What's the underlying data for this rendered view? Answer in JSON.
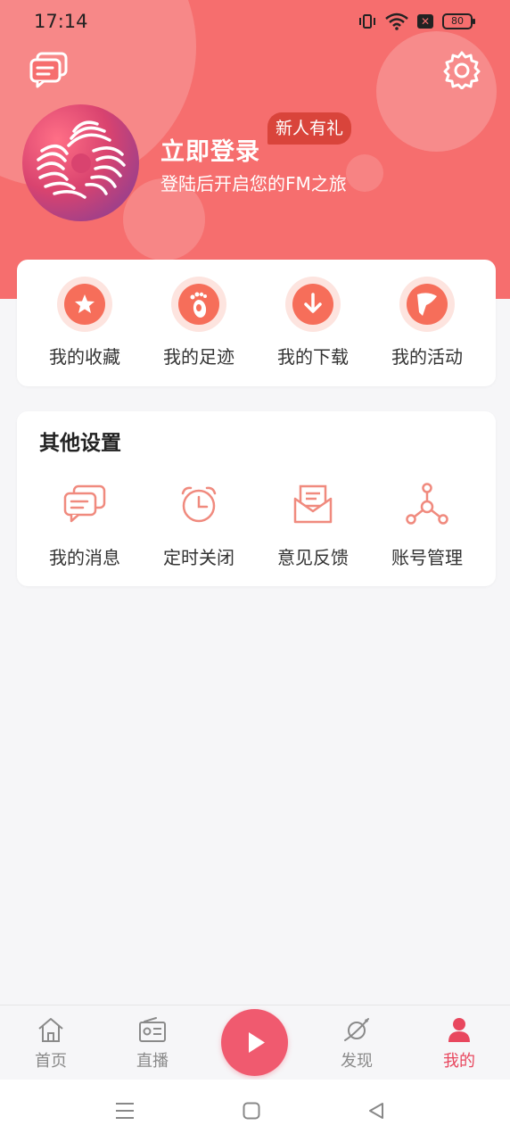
{
  "status_bar": {
    "time": "17:14",
    "battery": "80"
  },
  "profile": {
    "title": "立即登录",
    "subtitle": "登陆后开启您的FM之旅",
    "badge": "新人有礼"
  },
  "quick_actions": [
    {
      "label": "我的收藏",
      "icon": "star-icon"
    },
    {
      "label": "我的足迹",
      "icon": "footprint-icon"
    },
    {
      "label": "我的下载",
      "icon": "download-icon"
    },
    {
      "label": "我的活动",
      "icon": "flag-icon"
    }
  ],
  "other_settings": {
    "title": "其他设置",
    "items": [
      {
        "label": "我的消息",
        "icon": "message-icon"
      },
      {
        "label": "定时关闭",
        "icon": "alarm-clock-icon"
      },
      {
        "label": "意见反馈",
        "icon": "envelope-icon"
      },
      {
        "label": "账号管理",
        "icon": "account-network-icon"
      }
    ]
  },
  "tabbar": [
    {
      "label": "首页",
      "icon": "home-icon",
      "active": false
    },
    {
      "label": "直播",
      "icon": "radio-icon",
      "active": false
    },
    {
      "label": "",
      "icon": "play-icon",
      "active": false
    },
    {
      "label": "发现",
      "icon": "planet-icon",
      "active": false
    },
    {
      "label": "我的",
      "icon": "user-icon",
      "active": true
    }
  ],
  "colors": {
    "brand": "#f66e6e",
    "accent": "#f05a6f",
    "icon": "#f66e5a",
    "active_tab": "#e8475e"
  }
}
